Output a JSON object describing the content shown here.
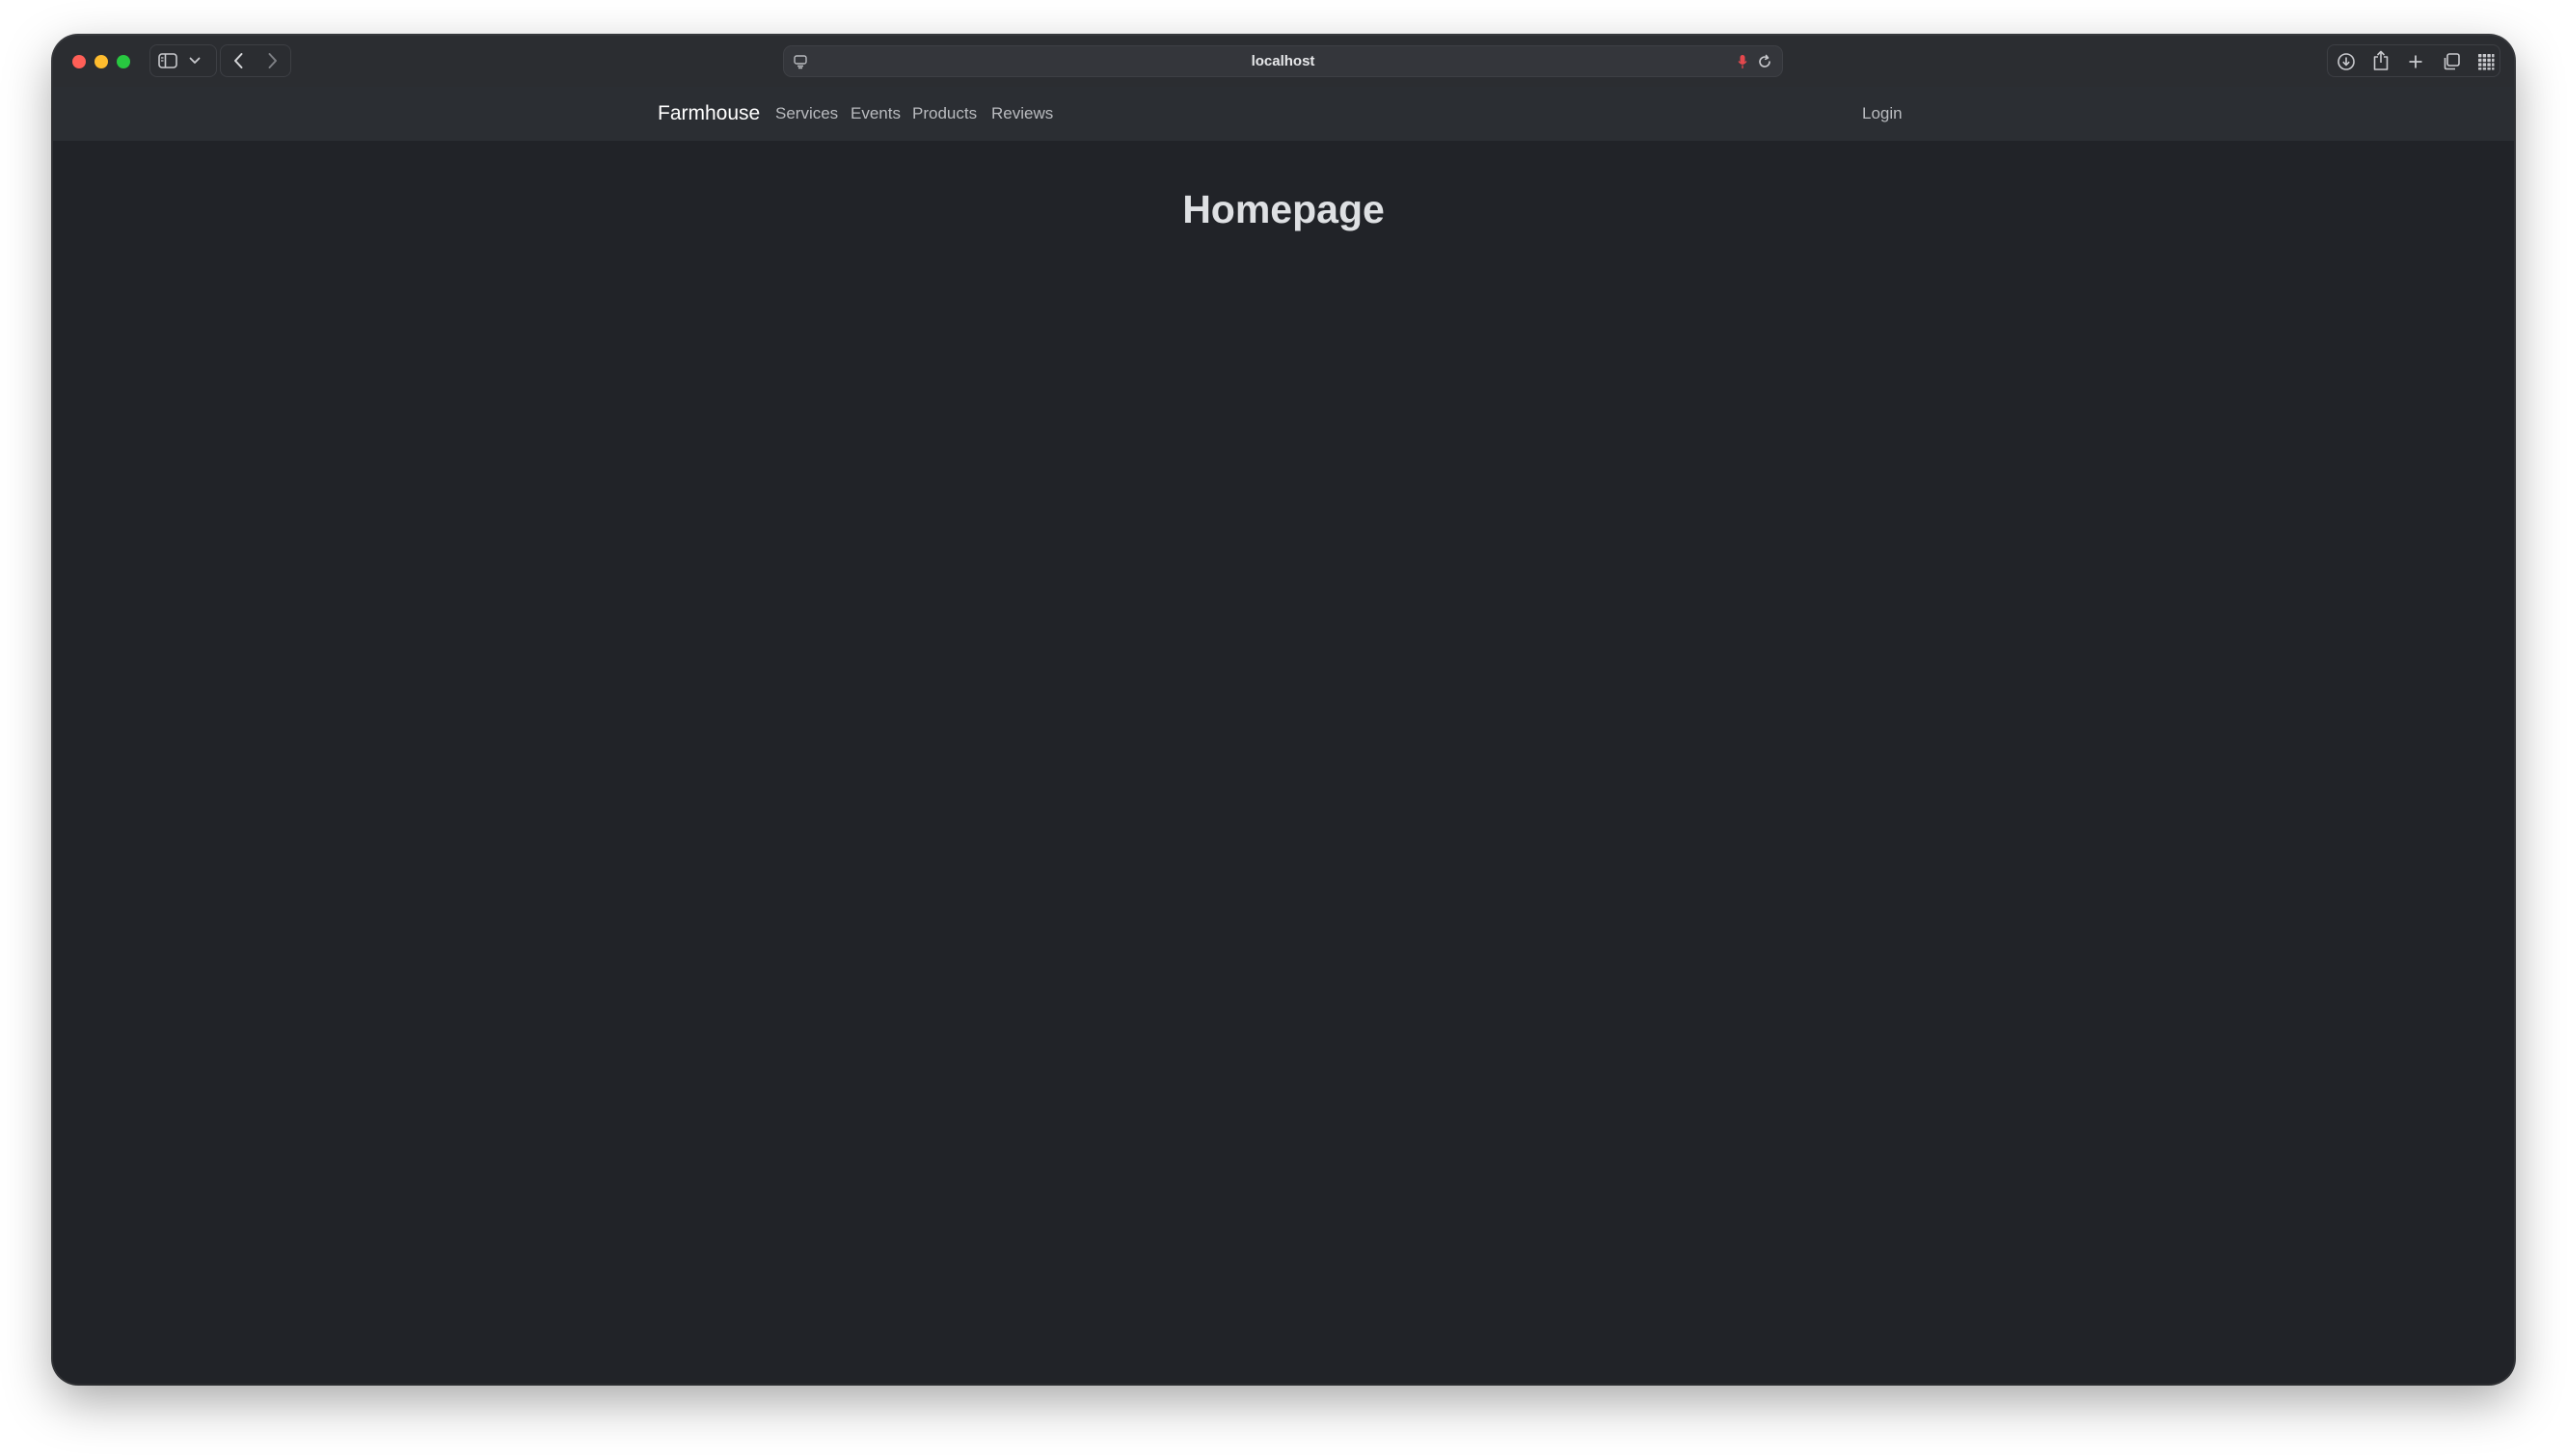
{
  "browser": {
    "url": "localhost",
    "colors": {
      "close": "#ff5f57",
      "minimize": "#febc2e",
      "maximize": "#28c840",
      "mic": "#e5484d"
    },
    "icons": [
      "sidebar-icon",
      "chevron-down-icon",
      "back-icon",
      "forward-icon",
      "page-settings-icon",
      "microphone-icon",
      "reload-icon",
      "download-icon",
      "share-icon",
      "new-tab-icon",
      "tab-overview-icon",
      "grid-icon"
    ]
  },
  "navbar": {
    "brand": "Farmhouse",
    "links": [
      "Services",
      "Events",
      "Products",
      "Reviews"
    ],
    "login": "Login"
  },
  "main": {
    "title": "Homepage"
  }
}
